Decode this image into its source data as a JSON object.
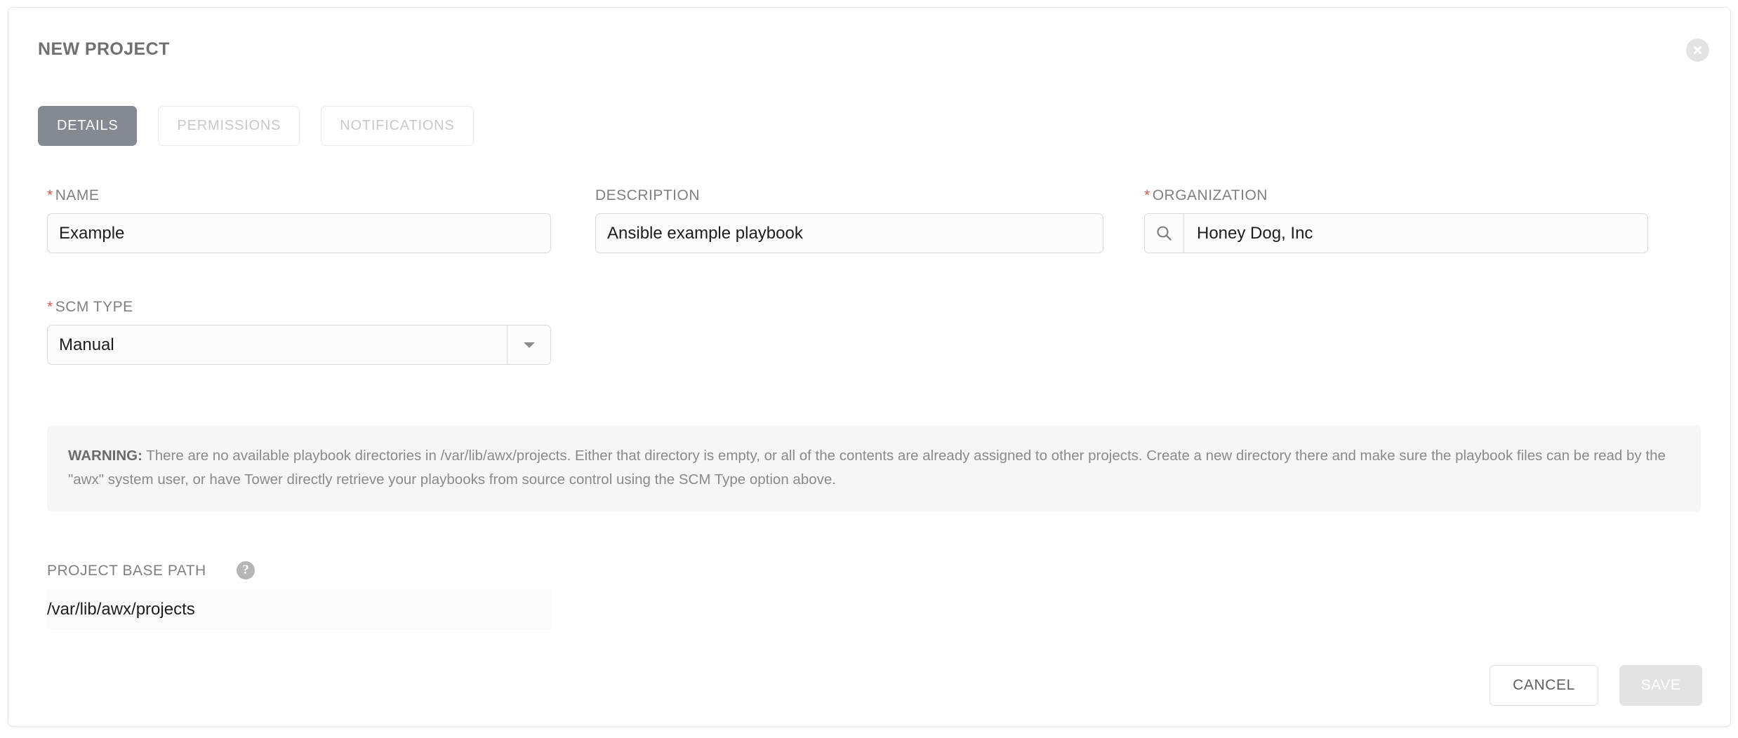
{
  "dialog": {
    "title": "NEW PROJECT",
    "close_icon": "close-circle-icon"
  },
  "tabs": [
    {
      "label": "DETAILS",
      "active": true
    },
    {
      "label": "PERMISSIONS",
      "active": false
    },
    {
      "label": "NOTIFICATIONS",
      "active": false
    }
  ],
  "fields": {
    "name": {
      "label": "NAME",
      "required_marker": "*",
      "value": "Example",
      "placeholder": ""
    },
    "description": {
      "label": "DESCRIPTION",
      "value": "Ansible example playbook",
      "placeholder": ""
    },
    "organization": {
      "label": "ORGANIZATION",
      "required_marker": "*",
      "value": "Honey Dog, Inc",
      "placeholder": "",
      "search_icon": "search-icon"
    },
    "scm_type": {
      "label": "SCM TYPE",
      "required_marker": "*",
      "value": "Manual",
      "caret_icon": "chevron-down-icon"
    },
    "project_base_path": {
      "label": "PROJECT BASE PATH",
      "value": "/var/lib/awx/projects",
      "help_icon": "question-mark-icon"
    }
  },
  "warning": {
    "prefix": "WARNING:",
    "text": " There are no available playbook directories in /var/lib/awx/projects. Either that directory is empty, or all of the contents are already assigned to other projects. Create a new directory there and make sure the playbook files can be read by the \"awx\" system user, or have Tower directly retrieve your playbooks from source control using the SCM Type option above."
  },
  "footer": {
    "cancel_label": "CANCEL",
    "save_label": "SAVE"
  },
  "colors": {
    "active_tab_bg": "#848992",
    "required_asterisk": "#d9534f",
    "warning_bg": "#f6f6f6",
    "disabled_button_bg": "#e3e3e3"
  }
}
